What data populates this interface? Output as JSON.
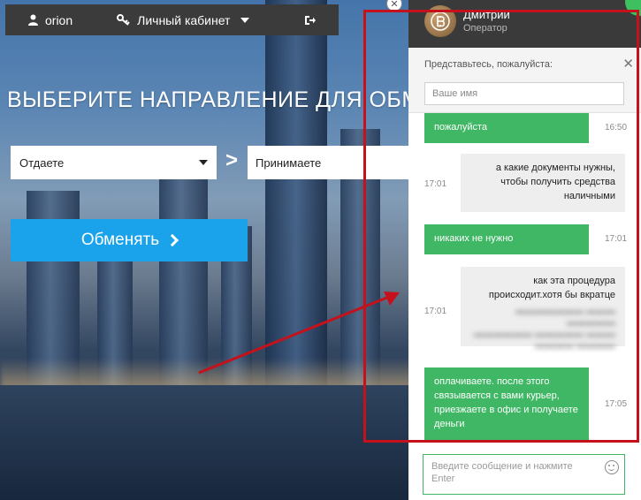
{
  "topbar": {
    "user_name": "orion",
    "cabinet_label": "Личный кабинет"
  },
  "exchange": {
    "headline": "ВЫБЕРИТЕ НАПРАВЛЕНИЕ ДЛЯ ОБМЕ",
    "give_label": "Отдаете",
    "take_label": "Принимаете",
    "button_label": "Обменять"
  },
  "chat": {
    "operator_name": "Дмитрии",
    "operator_role": "Оператор",
    "intro_label": "Представьтесь, пожалуйста:",
    "name_placeholder": "Ваше имя",
    "messages": [
      {
        "from": "operator",
        "text": "пожалуйста",
        "time": "16:50"
      },
      {
        "from": "user",
        "text": "а какие документы нужны, чтобы получить средства наличными",
        "time": "17:01"
      },
      {
        "from": "operator",
        "text": "никаких не нужно",
        "time": "17:01"
      },
      {
        "from": "user",
        "text": "как эта процедура происходит.хотя бы вкратце",
        "time": "17:01"
      },
      {
        "from": "operator",
        "text": "оплачиваете. после этого связывается с вами курьер, приезжаете в офис и получаете деньги",
        "time": "17:05"
      }
    ],
    "composer_placeholder": "Введите сообщение и нажмите Enter"
  },
  "colors": {
    "accent_blue": "#1aa3ea",
    "chat_green": "#3fb764",
    "annotation_red": "#c5111b",
    "topbar_dark": "#3b3b3b"
  }
}
